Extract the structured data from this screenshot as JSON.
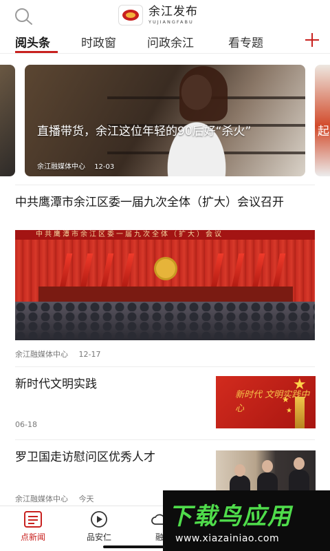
{
  "header": {
    "logo_cn": "余江发布",
    "logo_en": "YUJIANGFABU"
  },
  "tabs": [
    {
      "label": "阅头条",
      "active": true
    },
    {
      "label": "时政窗",
      "active": false
    },
    {
      "label": "问政余江",
      "active": false
    },
    {
      "label": "看专题",
      "active": false
    }
  ],
  "carousel": {
    "main": {
      "title": "直播带货，余江这位年轻的90后好“杀火”",
      "source": "余江融媒体中心",
      "date": "12-03"
    },
    "right_peek_title": "起"
  },
  "feed": [
    {
      "title": "中共鹰潭市余江区委一届九次全体（扩大）会议召开",
      "image_banner": "中共鹰潭市余江区委一届九次全体（扩大）会议",
      "source": "余江融媒体中心",
      "date": "12-17"
    },
    {
      "title": "新时代文明实践",
      "thumb_text": "新时代 文明实践中心",
      "source": "",
      "date": "06-18"
    },
    {
      "title": "罗卫国走访慰问区优秀人才",
      "source": "余江融媒体中心",
      "date": "今天"
    }
  ],
  "bottom_nav": [
    {
      "label": "点新闻",
      "icon": "news-list-icon",
      "active": true
    },
    {
      "label": "品安仁",
      "icon": "play-circle-icon",
      "active": false
    },
    {
      "label": "融",
      "icon": "cloud-icon",
      "active": false
    }
  ],
  "watermark": {
    "title": "下载鸟应用",
    "url": "www.xiazainiao.com"
  },
  "colors": {
    "accent": "#c8201e",
    "watermark_green": "#4fdc4b"
  }
}
